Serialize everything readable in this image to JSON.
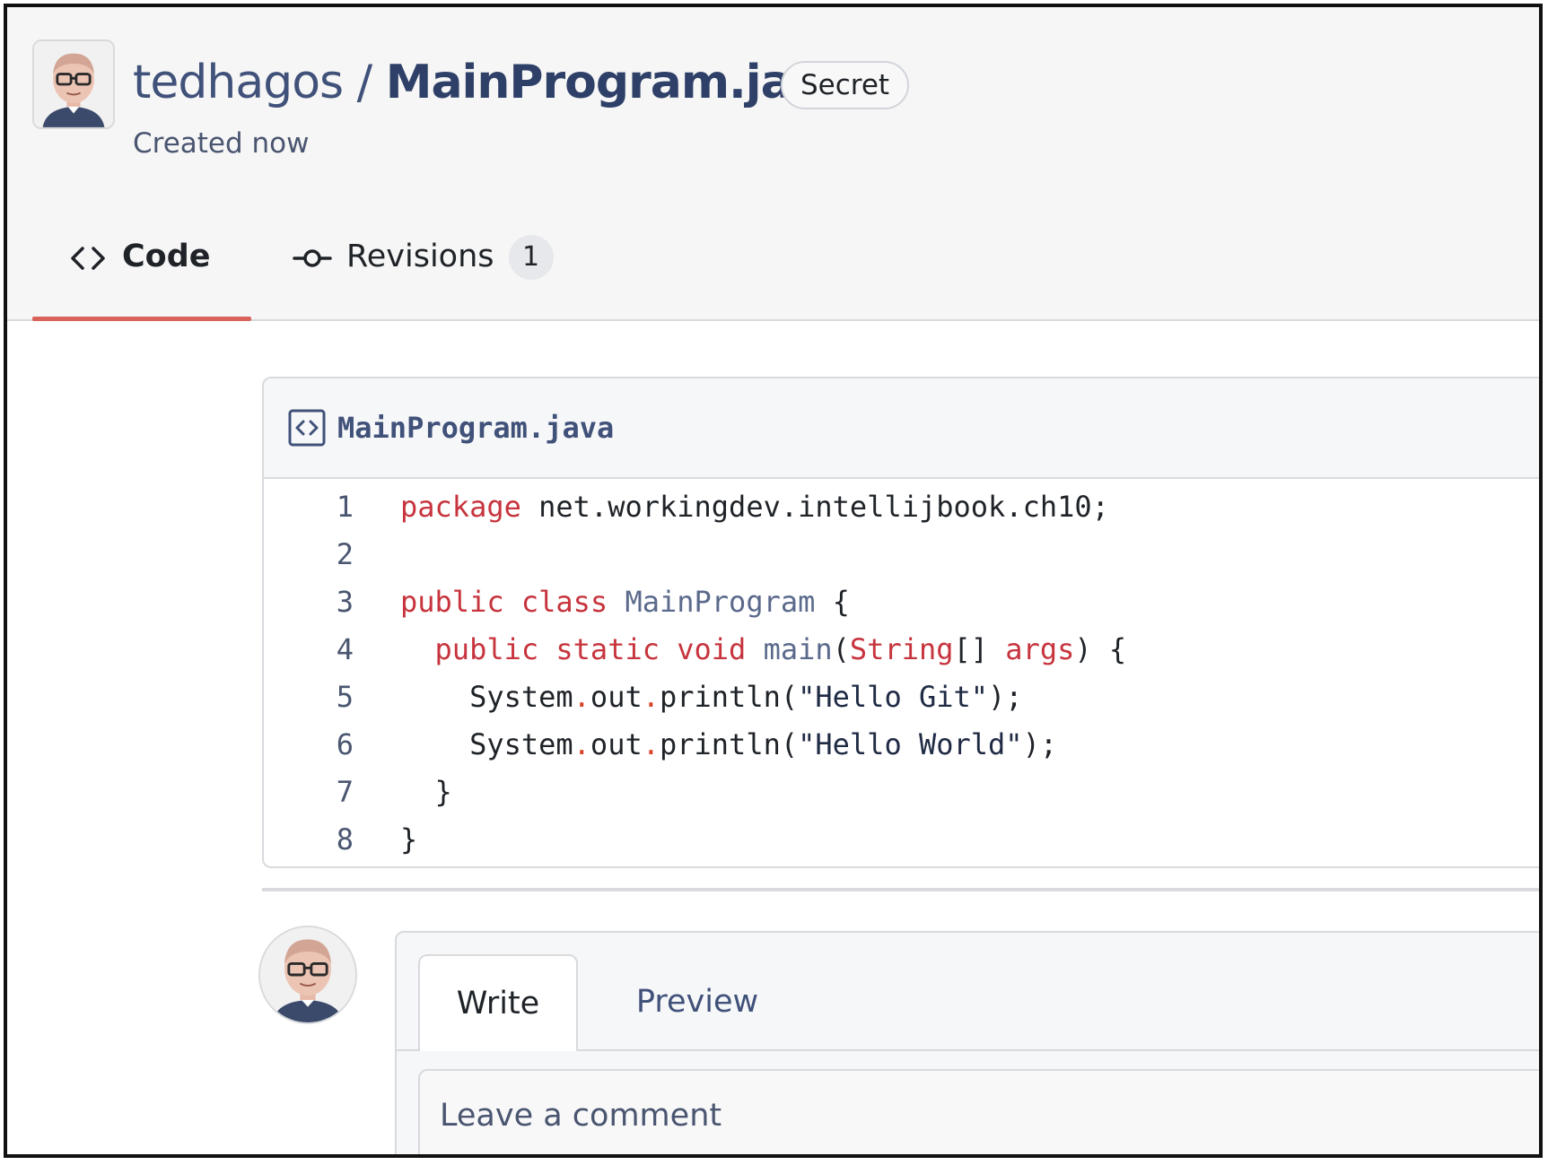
{
  "header": {
    "owner": "tedhagos",
    "separator": "/",
    "filename": "MainProgram.java",
    "visibility_badge": "Secret",
    "created": "Created now"
  },
  "tabs": [
    {
      "label": "Code",
      "icon": "code-icon",
      "active": true
    },
    {
      "label": "Revisions",
      "icon": "commit-icon",
      "count": "1"
    }
  ],
  "file": {
    "name": "MainProgram.java",
    "icon": "file-code-icon",
    "line_numbers": [
      "1",
      "2",
      "3",
      "4",
      "5",
      "6",
      "7",
      "8"
    ],
    "lines": [
      [
        {
          "t": "package",
          "c": "kw"
        },
        {
          "t": " net.workingdev.intellijbook.ch10;",
          "c": "txt"
        }
      ],
      [],
      [
        {
          "t": "public",
          "c": "kw"
        },
        {
          "t": " ",
          "c": "txt"
        },
        {
          "t": "class",
          "c": "kw"
        },
        {
          "t": " ",
          "c": "txt"
        },
        {
          "t": "MainProgram",
          "c": "ent"
        },
        {
          "t": " {",
          "c": "txt"
        }
      ],
      [
        {
          "t": "  ",
          "c": "txt"
        },
        {
          "t": "public",
          "c": "kw"
        },
        {
          "t": " ",
          "c": "txt"
        },
        {
          "t": "static",
          "c": "kw"
        },
        {
          "t": " ",
          "c": "txt"
        },
        {
          "t": "void",
          "c": "kw"
        },
        {
          "t": " ",
          "c": "txt"
        },
        {
          "t": "main",
          "c": "ent"
        },
        {
          "t": "(",
          "c": "txt"
        },
        {
          "t": "String",
          "c": "kw"
        },
        {
          "t": "[] ",
          "c": "txt"
        },
        {
          "t": "args",
          "c": "kw"
        },
        {
          "t": ") {",
          "c": "txt"
        }
      ],
      [
        {
          "t": "    System",
          "c": "txt"
        },
        {
          "t": ".",
          "c": "dot"
        },
        {
          "t": "out",
          "c": "txt"
        },
        {
          "t": ".",
          "c": "dot"
        },
        {
          "t": "println(",
          "c": "txt"
        },
        {
          "t": "\"Hello Git\"",
          "c": "str"
        },
        {
          "t": ");",
          "c": "txt"
        }
      ],
      [
        {
          "t": "    System",
          "c": "txt"
        },
        {
          "t": ".",
          "c": "dot"
        },
        {
          "t": "out",
          "c": "txt"
        },
        {
          "t": ".",
          "c": "dot"
        },
        {
          "t": "println(",
          "c": "txt"
        },
        {
          "t": "\"Hello World\"",
          "c": "str"
        },
        {
          "t": ");",
          "c": "txt"
        }
      ],
      [
        {
          "t": "  }",
          "c": "txt"
        }
      ],
      [
        {
          "t": "}",
          "c": "txt"
        }
      ]
    ]
  },
  "comment": {
    "write_tab": "Write",
    "preview_tab": "Preview",
    "placeholder": "Leave a comment"
  },
  "colors": {
    "keyword": "#c7343d",
    "entity": "#5b6a8c",
    "active_tab_underline": "#d9625a"
  }
}
